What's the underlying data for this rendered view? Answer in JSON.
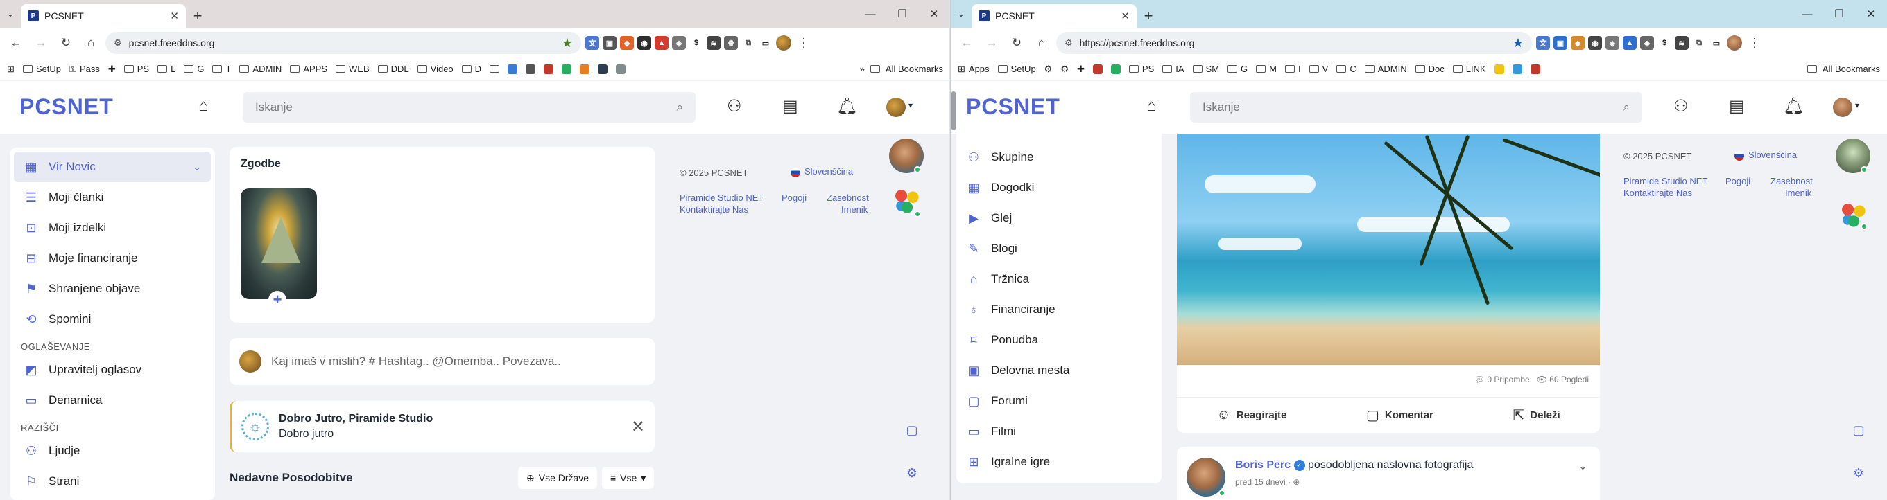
{
  "left": {
    "tab": {
      "title": "PCSNET"
    },
    "address": {
      "url": "pcsnet.freeddns.org"
    },
    "bookmarks": [
      "SetUp",
      "Pass",
      "PS",
      "L",
      "G",
      "T",
      "ADMIN",
      "APPS",
      "WEB",
      "DDL",
      "Video",
      "D"
    ],
    "all_bookmarks": "All Bookmarks",
    "site": {
      "logo": "PCSNET",
      "search_placeholder": "Iskanje"
    },
    "sidebar": {
      "items": [
        {
          "label": "Vir Novic",
          "icon": "news-icon"
        },
        {
          "label": "Moji članki",
          "icon": "article-icon"
        },
        {
          "label": "Moji izdelki",
          "icon": "bag-icon"
        },
        {
          "label": "Moje financiranje",
          "icon": "funding-icon"
        },
        {
          "label": "Shranjene objave",
          "icon": "bookmark-icon"
        },
        {
          "label": "Spomini",
          "icon": "memories-icon"
        }
      ],
      "section_ads": "OGLAŠEVANJE",
      "ads_items": [
        {
          "label": "Upravitelj oglasov",
          "icon": "megaphone-icon"
        },
        {
          "label": "Denarnica",
          "icon": "wallet-icon"
        }
      ],
      "section_explore": "RAZIŠČI",
      "explore_items": [
        {
          "label": "Ljudje",
          "icon": "people-icon"
        },
        {
          "label": "Strani",
          "icon": "pages-icon"
        }
      ]
    },
    "stories": {
      "title": "Zgodbe"
    },
    "composer": {
      "placeholder": "Kaj imaš v mislih? # Hashtag.. @Omemba.. Povezava.."
    },
    "greeting": {
      "title": "Dobro Jutro, Piramide Studio",
      "subtitle": "Dobro jutro"
    },
    "updates": {
      "title": "Nedavne Posodobitve",
      "filter_countries": "Vse Države",
      "filter_all": "Vse"
    },
    "meta": {
      "copyright": "© 2025 PCSNET",
      "language": "Slovenščina",
      "links": [
        "Piramide Studio NET",
        "Pogoji",
        "Zasebnost",
        "Kontaktirajte Nas",
        "Imenik"
      ]
    }
  },
  "right": {
    "tab": {
      "title": "PCSNET"
    },
    "address": {
      "url": "https://pcsnet.freeddns.org"
    },
    "bookmarks": [
      "Apps",
      "SetUp",
      "PS",
      "IA",
      "SM",
      "G",
      "M",
      "I",
      "V",
      "C",
      "ADMIN",
      "Doc",
      "LINK"
    ],
    "all_bookmarks": "All Bookmarks",
    "site": {
      "logo": "PCSNET",
      "search_placeholder": "Iskanje"
    },
    "nav": [
      {
        "label": "Skupine",
        "icon": "groups-icon"
      },
      {
        "label": "Dogodki",
        "icon": "calendar-icon"
      },
      {
        "label": "Glej",
        "icon": "video-icon"
      },
      {
        "label": "Blogi",
        "icon": "blog-icon"
      },
      {
        "label": "Tržnica",
        "icon": "store-icon"
      },
      {
        "label": "Financiranje",
        "icon": "funding-icon"
      },
      {
        "label": "Ponudba",
        "icon": "offer-icon"
      },
      {
        "label": "Delovna mesta",
        "icon": "jobs-icon"
      },
      {
        "label": "Forumi",
        "icon": "forum-icon"
      },
      {
        "label": "Filmi",
        "icon": "film-icon"
      },
      {
        "label": "Igralne igre",
        "icon": "game-icon"
      }
    ],
    "post": {
      "comments": "0 Pripombe",
      "views": "60 Pogledi",
      "react": "Reagirajte",
      "comment": "Komentar",
      "share": "Deleži"
    },
    "post2": {
      "author": "Boris Perc",
      "action": "posodobljena naslovna fotografija",
      "time": "pred 15 dnevi"
    },
    "meta": {
      "copyright": "© 2025 PCSNET",
      "language": "Slovenščina",
      "links": [
        "Piramide Studio NET",
        "Pogoji",
        "Zasebnost",
        "Kontaktirajte Nas",
        "Imenik"
      ]
    }
  }
}
